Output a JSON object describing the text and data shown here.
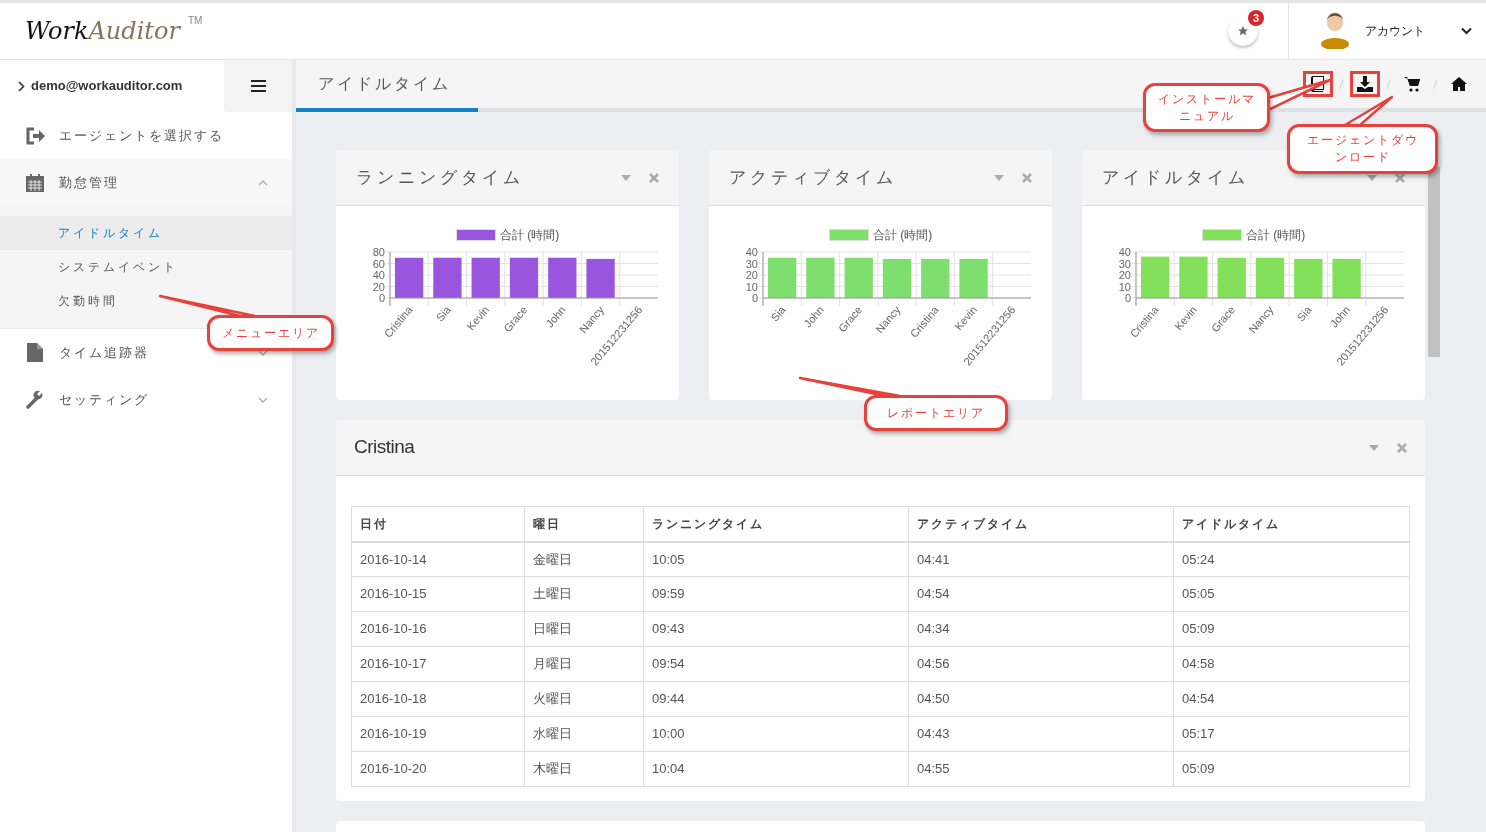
{
  "header": {
    "logo_dark": "Work",
    "logo_light": "Auditor",
    "trademark": "TM",
    "notification_count": "3",
    "account_label": "アカウント"
  },
  "sidebar": {
    "user": "demo@workauditor.com",
    "items": [
      {
        "label": "エージェントを選択する"
      },
      {
        "label": "勤怠管理",
        "expanded": true,
        "children": [
          {
            "label": "アイドルタイム",
            "selected": true
          },
          {
            "label": "システムイベント",
            "selected": false
          },
          {
            "label": "欠勤時間",
            "selected": false
          }
        ]
      },
      {
        "label": "タイム追跡器",
        "expanded": false
      },
      {
        "label": "セッティング",
        "expanded": false
      }
    ]
  },
  "page_tab": {
    "title": "アイドルタイム"
  },
  "toolbar": [
    {
      "kind": "book",
      "highlighted": true
    },
    {
      "kind": "download",
      "highlighted": true
    },
    {
      "kind": "cart",
      "highlighted": false
    },
    {
      "kind": "home",
      "highlighted": false
    }
  ],
  "charts": [
    {
      "title": "ランニングタイム",
      "chart_data": {
        "type": "bar",
        "categories": [
          "Cristina",
          "Sia",
          "Kevin",
          "Grace",
          "John",
          "Nancy",
          "201512231256"
        ],
        "series": [
          {
            "name": "合計 (時間)",
            "color": "#9955dd",
            "values": [
              70,
              70,
              70,
              70,
              70,
              68,
              0
            ]
          }
        ],
        "ylim": [
          0,
          80
        ],
        "yticks": [
          0,
          20,
          40,
          60,
          80
        ],
        "grid": true
      }
    },
    {
      "title": "アクティブタイム",
      "chart_data": {
        "type": "bar",
        "categories": [
          "Sia",
          "John",
          "Grace",
          "Nancy",
          "Cristina",
          "Kevin",
          "201512231256"
        ],
        "series": [
          {
            "name": "合計 (時間)",
            "color": "#7ede6e",
            "values": [
              35,
              35,
              35,
              34,
              34,
              34,
              0
            ]
          }
        ],
        "ylim": [
          0,
          40
        ],
        "yticks": [
          0,
          10,
          20,
          30,
          40
        ],
        "grid": true
      }
    },
    {
      "title": "アイドルタイム",
      "chart_data": {
        "type": "bar",
        "categories": [
          "Cristina",
          "Kevin",
          "Grace",
          "Nancy",
          "Sia",
          "John",
          "201512231256"
        ],
        "series": [
          {
            "name": "合計 (時間)",
            "color": "#82e05a",
            "values": [
              36,
              36,
              35,
              35,
              34,
              34,
              0
            ]
          }
        ],
        "ylim": [
          0,
          40
        ],
        "yticks": [
          0,
          10,
          20,
          30,
          40
        ],
        "grid": true
      }
    }
  ],
  "table_panel": {
    "title": "Cristina",
    "columns": [
      "日付",
      "曜日",
      "ランニングタイム",
      "アクティブタイム",
      "アイドルタイム"
    ],
    "rows": [
      [
        "2016-10-14",
        "金曜日",
        "10:05",
        "04:41",
        "05:24"
      ],
      [
        "2016-10-15",
        "土曜日",
        "09:59",
        "04:54",
        "05:05"
      ],
      [
        "2016-10-16",
        "日曜日",
        "09:43",
        "04:34",
        "05:09"
      ],
      [
        "2016-10-17",
        "月曜日",
        "09:54",
        "04:56",
        "04:58"
      ],
      [
        "2016-10-18",
        "火曜日",
        "09:44",
        "04:50",
        "04:54"
      ],
      [
        "2016-10-19",
        "水曜日",
        "10:00",
        "04:43",
        "05:17"
      ],
      [
        "2016-10-20",
        "木曜日",
        "10:04",
        "04:55",
        "05:09"
      ]
    ]
  },
  "callouts": [
    {
      "text": "メニューエリア"
    },
    {
      "text": "レポートエリア"
    },
    {
      "text": "インストールマニュアル"
    },
    {
      "text": "エージェントダウンロード"
    }
  ]
}
